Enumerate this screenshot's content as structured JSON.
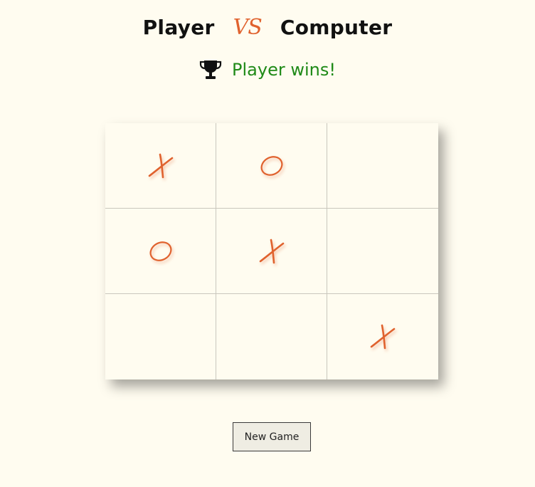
{
  "header": {
    "player_name": "Player",
    "vs_label": "VS",
    "opponent_name": "Computer"
  },
  "status": {
    "icon": "trophy-icon",
    "text": "Player wins!",
    "color": "#1f8a17"
  },
  "board": {
    "cells": [
      [
        "X",
        "O",
        ""
      ],
      [
        "O",
        "X",
        ""
      ],
      [
        "",
        "",
        "X"
      ]
    ],
    "mark_color": "#e0622e"
  },
  "controls": {
    "new_game_label": "New Game"
  }
}
